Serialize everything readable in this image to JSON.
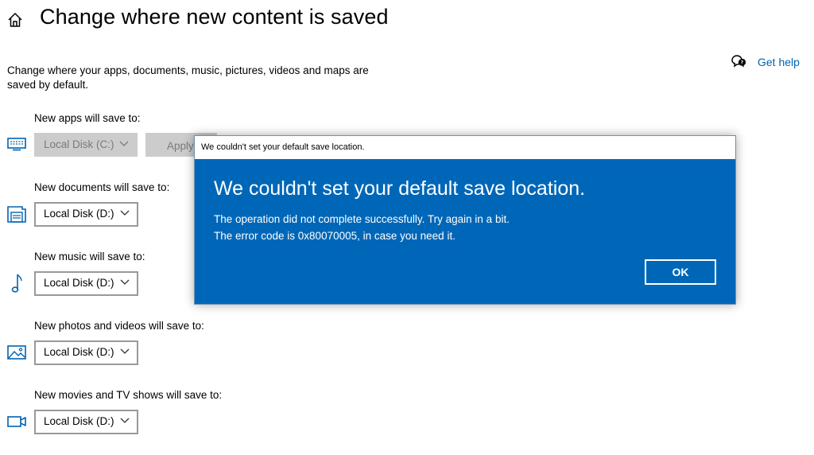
{
  "header": {
    "title": "Change where new content is saved",
    "help_label": "Get help"
  },
  "description": "Change where your apps, documents, music, pictures, videos and maps are saved by default.",
  "sections": {
    "apps": {
      "label": "New apps will save to:",
      "value": "Local Disk (C:)",
      "icon": "monitor-icon",
      "disabled": true
    },
    "apply_label": "Apply",
    "documents": {
      "label": "New documents will save to:",
      "value": "Local Disk (D:)",
      "icon": "documents-icon"
    },
    "music": {
      "label": "New music will save to:",
      "value": "Local Disk (D:)",
      "icon": "music-note-icon"
    },
    "photos": {
      "label": "New photos and videos will save to:",
      "value": "Local Disk (D:)",
      "icon": "photo-icon"
    },
    "movies": {
      "label": "New movies and TV shows will save to:",
      "value": "Local Disk (D:)",
      "icon": "video-camera-icon"
    }
  },
  "dialog": {
    "title": "We couldn't set your default save location.",
    "heading": "We couldn't set your default save location.",
    "line1": "The operation did not complete successfully. Try again in a bit.",
    "line2": "The error code is 0x80070005, in case you need it.",
    "ok_label": "OK",
    "background": "#0067b8"
  },
  "colors": {
    "link": "#0063b1",
    "disabled_bg": "#cccccc"
  }
}
